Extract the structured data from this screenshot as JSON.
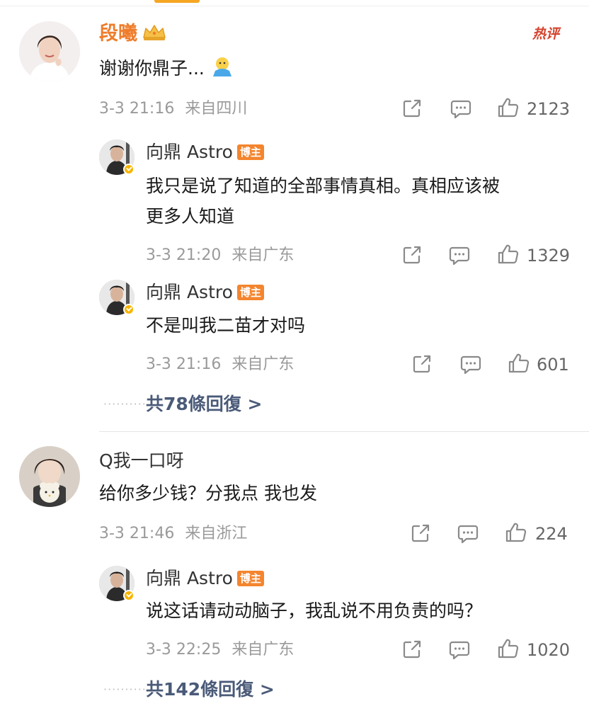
{
  "comments": [
    {
      "author": "段曦",
      "hot_label": "热评",
      "text": "谢谢你鼎子...",
      "emoji": "blue-face-emoji",
      "time": "3-3 21:16",
      "location": "来自四川",
      "likes": "2123",
      "replies": [
        {
          "author": "向鼎 Astro",
          "badge": "博主",
          "text_lines": [
            "我只是说了知道的全部事情真相。真相应该被",
            "更多人知道"
          ],
          "time": "3-3 21:20",
          "location": "来自广东",
          "likes": "1329"
        },
        {
          "author": "向鼎 Astro",
          "badge": "博主",
          "text_lines": [
            "不是叫我二苗才对吗"
          ],
          "time": "3-3 21:16",
          "location": "来自广东",
          "likes": "601"
        }
      ],
      "more_replies": "共78條回復 >"
    },
    {
      "author": "Q我一口呀",
      "text": "给你多少钱？分我点 我也发",
      "time": "3-3 21:46",
      "location": "来自浙江",
      "likes": "224",
      "replies": [
        {
          "author": "向鼎 Astro",
          "badge": "博主",
          "text_lines": [
            "说这话请动动脑子，我乱说不用负责的吗？"
          ],
          "time": "3-3 22:25",
          "location": "来自广东",
          "likes": "1020"
        }
      ],
      "more_replies": "共142條回復 >"
    }
  ],
  "icons": {
    "share": "share-icon",
    "comment": "comment-icon",
    "like": "thumbs-up-icon",
    "crown": "crown-icon",
    "verified": "verified-badge-icon"
  },
  "colors": {
    "vip_name": "#ef7c2a",
    "badge": "#f4852e",
    "hot": "#d4442e",
    "link": "#4a5a78",
    "meta": "#9a9a9a"
  }
}
